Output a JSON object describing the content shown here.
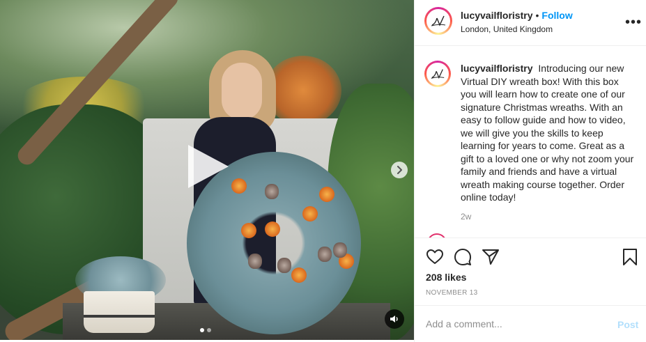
{
  "post": {
    "username": "lucyvailfloristry",
    "separator": "•",
    "follow_label": "Follow",
    "location": "London, United Kingdom",
    "more_label": "•••",
    "caption_text": "Introducing our new Virtual DIY wreath box! With this box you will learn how to create one of our signature Christmas wreaths. With an easy to follow guide and how to video, we will give you the skills to keep learning for years to come. Great as a gift to a loved one or why not zoom your family and friends and have a virtual wreath making course together. Order online today!",
    "time_ago": "2w",
    "likes": "208 likes",
    "date": "NOVEMBER 13",
    "comment_placeholder": "Add a comment...",
    "post_label": "Post",
    "avatar_text": "LV"
  },
  "media": {
    "type": "video",
    "carousel_count": 2,
    "carousel_active": 1
  },
  "colors": {
    "follow": "#0095f6",
    "post_disabled": "#b2dffc",
    "muted_text": "#8e8e8e"
  },
  "icons": {
    "play": "play-icon",
    "next": "chevron-right-icon",
    "audio": "speaker-icon",
    "like": "heart-icon",
    "comment": "comment-icon",
    "share": "send-icon",
    "save": "bookmark-icon",
    "more": "more-icon"
  }
}
